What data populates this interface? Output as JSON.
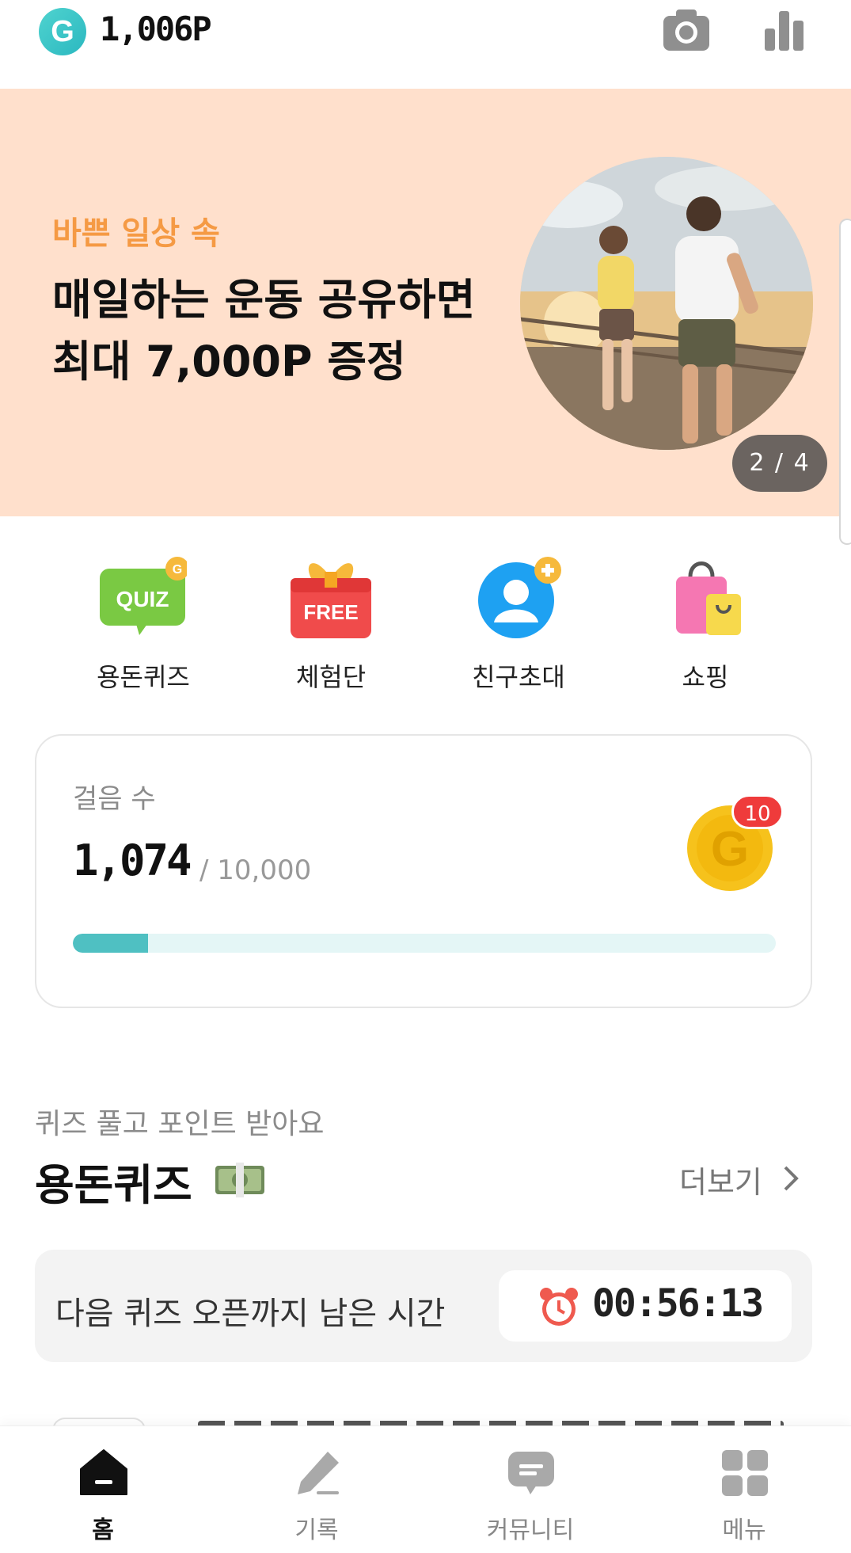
{
  "header": {
    "logo_letter": "G",
    "points": "1,006P"
  },
  "banner": {
    "subtitle": "바쁜 일상 속",
    "title_line1": "매일하는 운동 공유하면",
    "title_line2": "최대 7,000P 증정",
    "page_indicator": "2 / 4",
    "bg_color": "#ffe0cc"
  },
  "shortcuts": [
    {
      "label": "용돈퀴즈",
      "icon": "quiz-icon"
    },
    {
      "label": "체험단",
      "icon": "free-gift-icon"
    },
    {
      "label": "친구초대",
      "icon": "invite-friend-icon"
    },
    {
      "label": "쇼핑",
      "icon": "shopping-bag-icon"
    }
  ],
  "steps": {
    "label": "걸음 수",
    "current": "1,074",
    "goal": "/ 10,000",
    "coin_badge": "10",
    "progress": 0.107
  },
  "quiz": {
    "subtitle": "퀴즈 풀고 포인트 받아요",
    "title": "용돈퀴즈",
    "more_label": "더보기",
    "timer_label": "다음 퀴즈 오픈까지 남은 시간",
    "timer_value": "00:56:13"
  },
  "bottom_nav": [
    {
      "label": "홈",
      "icon": "home-icon",
      "active": true
    },
    {
      "label": "기록",
      "icon": "pencil-icon",
      "active": false
    },
    {
      "label": "커뮤니티",
      "icon": "chat-icon",
      "active": false
    },
    {
      "label": "메뉴",
      "icon": "grid-icon",
      "active": false
    }
  ],
  "colors": {
    "accent": "#4fc0c2",
    "banner_subtitle": "#f59a44",
    "badge_red": "#ef3b3b"
  }
}
